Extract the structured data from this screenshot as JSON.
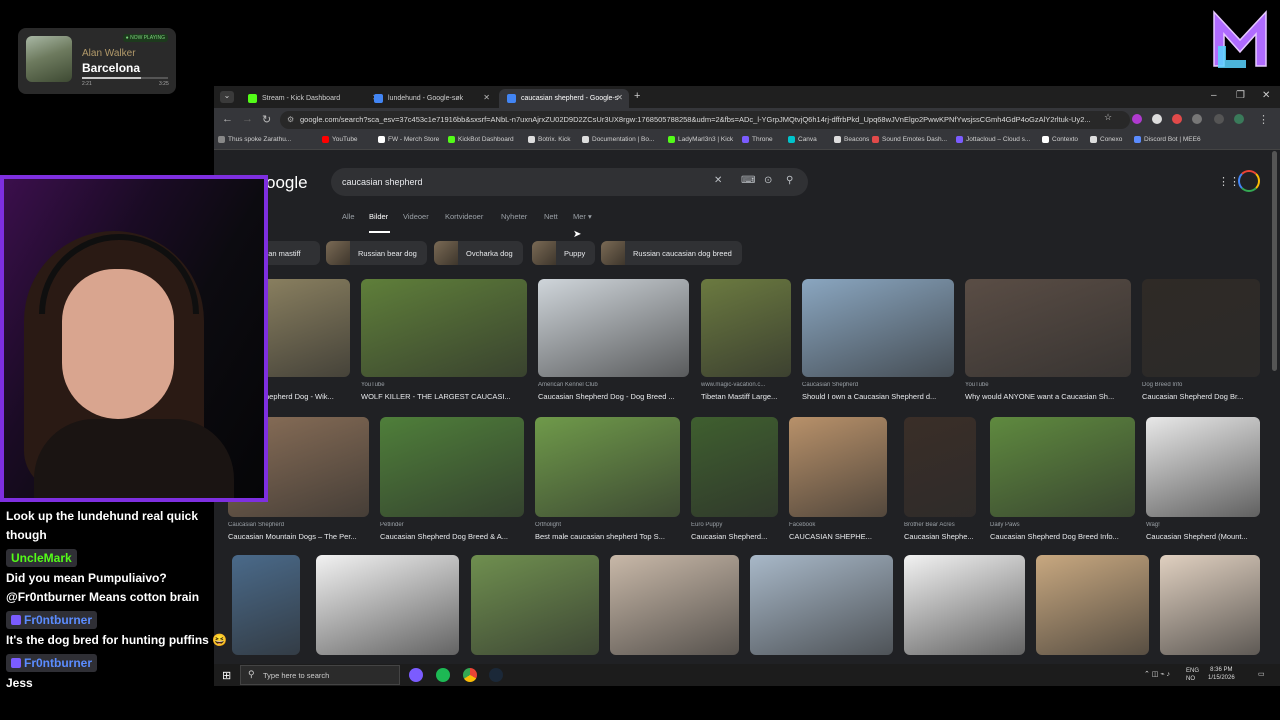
{
  "now_playing": {
    "badge": "● NOW PLAYING",
    "artist": "Alan Walker",
    "title": "Barcelona",
    "elapsed": "2:21",
    "duration": "3:25",
    "progress": 0.69
  },
  "browser": {
    "tabs": [
      {
        "label": "Stream - Kick Dashboard",
        "favicon_color": "#53fc18"
      },
      {
        "label": "lundehund - Google-søk",
        "favicon_color": "#4285f4"
      },
      {
        "label": "caucasian shepherd - Google-s",
        "favicon_color": "#4285f4",
        "active": true
      }
    ],
    "new_tab": "+",
    "url": "google.com/search?sca_esv=37c453c1e71916bb&sxsrf=ANbL-n7uxnAjrxZU02D9D2ZCsUr3UX8rgw:1768505788258&udm=2&fbs=ADc_l-YGrpJMQtvjQ6h14rj-dffrbPkd_Upq68wJVnElgo2PwwKPNfYwsjssCGmh4GdP4oGzAlY2rltuk-Uy2...",
    "bookmarks": [
      {
        "label": "Thus spoke Zarathu...",
        "color": "#888888"
      },
      {
        "label": "YouTube",
        "color": "#ff0000"
      },
      {
        "label": "FW - Merch Store",
        "color": "#ffffff"
      },
      {
        "label": "KickBot Dashboard",
        "color": "#53fc18"
      },
      {
        "label": "Botrix. Kick",
        "color": "#dddddd"
      },
      {
        "label": "Documentation | Bo...",
        "color": "#dddddd"
      },
      {
        "label": "LadyMarl3n3 | Kick",
        "color": "#53fc18"
      },
      {
        "label": "Throne",
        "color": "#7b5cff"
      },
      {
        "label": "Canva",
        "color": "#00c4cc"
      },
      {
        "label": "Beacons",
        "color": "#dddddd"
      },
      {
        "label": "Sound Emotes Dash...",
        "color": "#e24a4a"
      },
      {
        "label": "Jottacloud – Cloud s...",
        "color": "#7b5cff"
      },
      {
        "label": "Contexto",
        "color": "#ffffff"
      },
      {
        "label": "Conexo",
        "color": "#dddddd"
      },
      {
        "label": "Discord Bot | MEE6",
        "color": "#5b8cff"
      }
    ]
  },
  "google": {
    "logo": "oogle",
    "query": "caucasian shepherd",
    "filters": [
      "Alle",
      "Bilder",
      "Videoer",
      "Kortvideoer",
      "Nyheter",
      "Nett",
      "Mer ▾"
    ],
    "chips": [
      "etan mastiff",
      "Russian bear dog",
      "Ovcharka dog",
      "Puppy",
      "Russian caucasian dog breed"
    ],
    "row1": [
      {
        "source": "",
        "title": "Shepherd Dog - Wik...",
        "color": "#8a8060"
      },
      {
        "source": "YouTube",
        "title": "WOLF KILLER - THE LARGEST CAUCASI...",
        "color": "#5f7f3a"
      },
      {
        "source": "American Kennel Club",
        "title": "Caucasian Shepherd Dog - Dog Breed ...",
        "color": "#cfd5da"
      },
      {
        "source": "www.magic-vacation.c...",
        "title": "Tibetan Mastiff Large...",
        "color": "#6b7a40"
      },
      {
        "source": "Caucasian Shepherd",
        "title": "Should I own a Caucasian Shepherd d...",
        "color": "#8aa6c0"
      },
      {
        "source": "YouTube",
        "title": "Why would ANYONE want a Caucasian Sh...",
        "color": "#5a4d45"
      },
      {
        "source": "Dog Breed Info",
        "title": "Caucasian Shepherd Dog Br...",
        "color": "#2f2a26"
      }
    ],
    "row2": [
      {
        "source": "Caucasian Shepherd",
        "title": "Caucasian Mountain Dogs – The Per...",
        "color": "#8a6f58"
      },
      {
        "source": "Petlinder",
        "title": "Caucasian Shepherd Dog Breed & A...",
        "color": "#4f7f3a"
      },
      {
        "source": "Ortholight",
        "title": "Best male caucasian shepherd Top S...",
        "color": "#6f9a4a"
      },
      {
        "source": "Euro Puppy",
        "title": "Caucasian Shepherd...",
        "color": "#3f5f2f"
      },
      {
        "source": "Facebook",
        "title": "CAUCASIAN SHEPHE...",
        "color": "#b8916a"
      },
      {
        "source": "Brother Bear Acres",
        "title": "Caucasian Shephe...",
        "color": "#3a2e28"
      },
      {
        "source": "Daily Paws",
        "title": "Caucasian Shepherd Dog Breed Info...",
        "color": "#5f8a3f"
      },
      {
        "source": "Wag!",
        "title": "Caucasian Shepherd (Mount...",
        "color": "#e8e8e8"
      }
    ],
    "row3": [
      {
        "color": "#4a6a8a"
      },
      {
        "color": "#f2f2f2"
      },
      {
        "color": "#6f8f4f"
      },
      {
        "color": "#c8b8a8"
      },
      {
        "color": "#a8b8c8"
      },
      {
        "color": "#f2f2f2"
      },
      {
        "color": "#c8a880"
      },
      {
        "color": "#e0d0c0"
      }
    ]
  },
  "taskbar": {
    "search_placeholder": "Type here to search",
    "lang1": "ENG",
    "lang2": "NO",
    "time": "8:36 PM",
    "date": "1/15/2026"
  },
  "chat": [
    {
      "type": "msg",
      "text": "Look up the lundehund real quick"
    },
    {
      "type": "msg",
      "text": "though"
    },
    {
      "type": "user",
      "name": "UncleMark",
      "color": "#53fc18",
      "badge": ""
    },
    {
      "type": "msg",
      "text": "Did you mean Pumpuliaivo?"
    },
    {
      "type": "msg",
      "text": "@Fr0ntburner Means cotton brain"
    },
    {
      "type": "user",
      "name": "Fr0ntburner",
      "color": "#5b8cff",
      "badge": "#7b5cff"
    },
    {
      "type": "msg",
      "text": "It's the dog bred for hunting puffins 😆"
    },
    {
      "type": "user",
      "name": "Fr0ntburner",
      "color": "#5b8cff",
      "badge": "#7b5cff"
    },
    {
      "type": "msg",
      "text": "Jess"
    }
  ]
}
